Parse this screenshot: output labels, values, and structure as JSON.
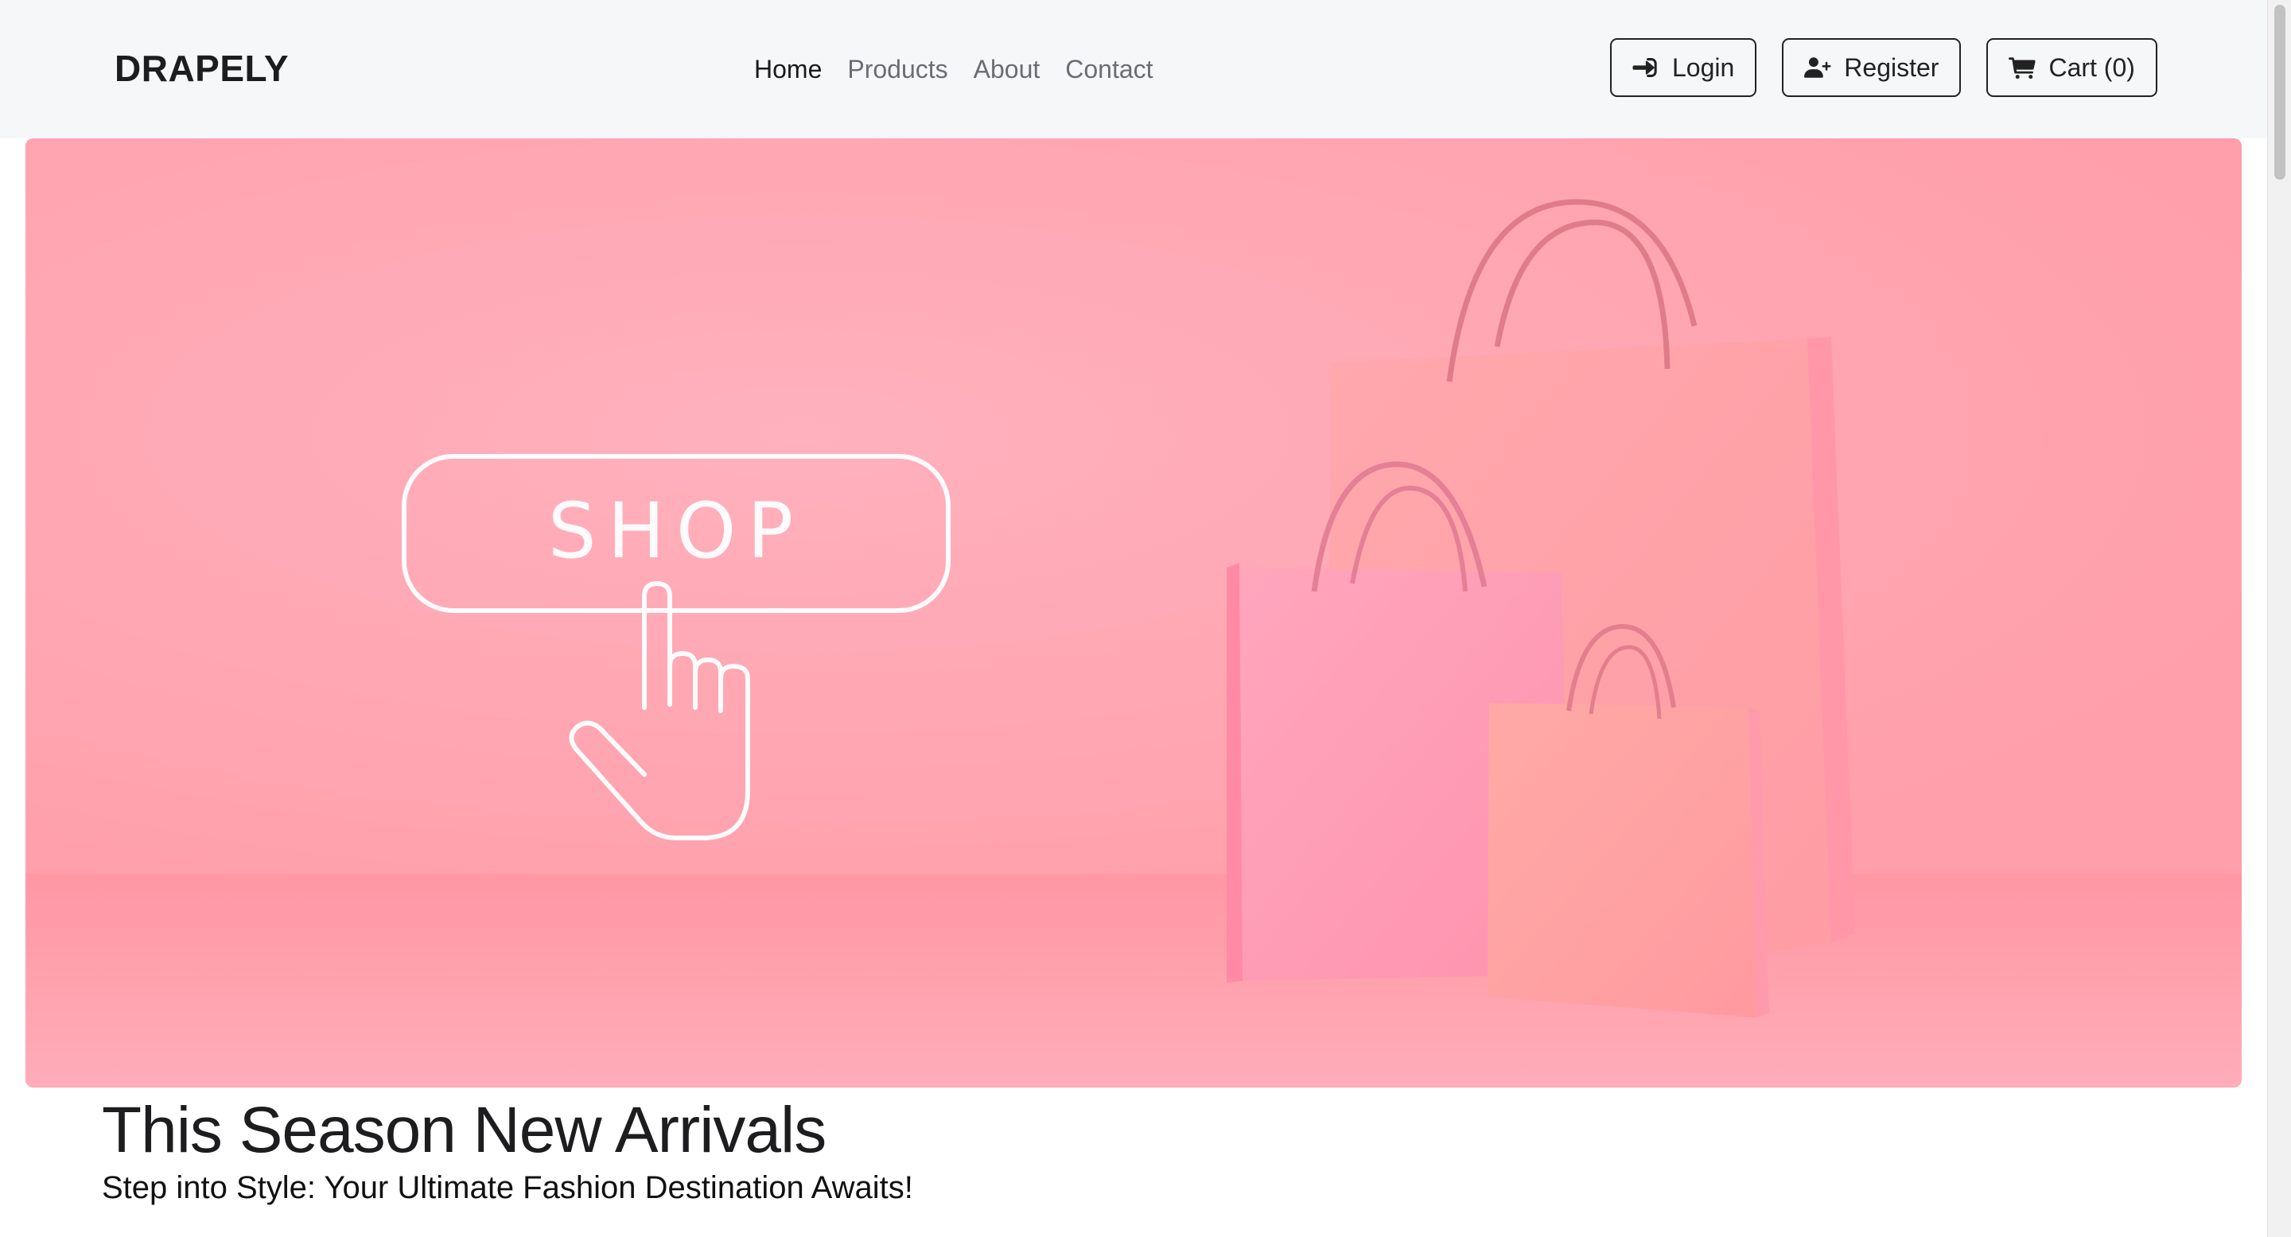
{
  "navbar": {
    "brand": "DRAPELY",
    "links": [
      {
        "label": "Home",
        "active": true
      },
      {
        "label": "Products",
        "active": false
      },
      {
        "label": "About",
        "active": false
      },
      {
        "label": "Contact",
        "active": false
      }
    ],
    "login_label": "Login",
    "register_label": "Register",
    "cart_label": "Cart (0)"
  },
  "hero": {
    "image_text": "SHOP",
    "title": "This Season New Arrivals",
    "subtitle": "Step into Style: Your Ultimate Fashion Destination Awaits!"
  },
  "icons": {
    "login": "sign-in-icon",
    "register": "user-plus-icon",
    "cart": "shopping-cart-icon"
  },
  "colors": {
    "hero_pink": "#ffa5b2",
    "navbar_bg": "#f6f7f9",
    "text_dark": "#1d1d1f"
  }
}
